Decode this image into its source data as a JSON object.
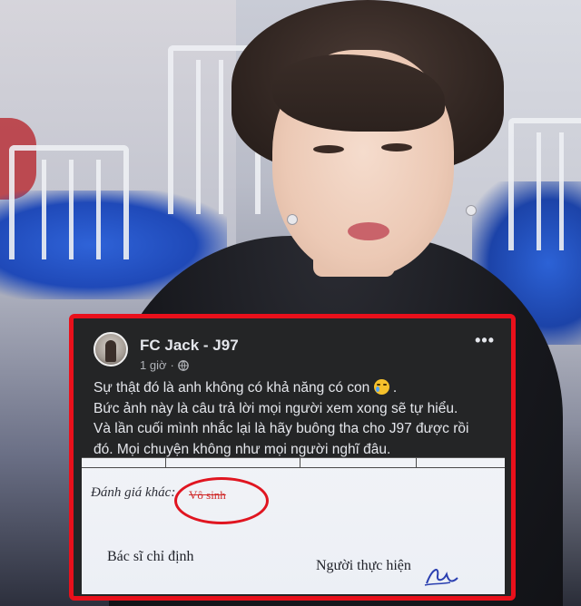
{
  "post": {
    "page_name": "FC Jack - J97",
    "time": "1 giờ",
    "separator": "·",
    "privacy_icon": "globe-icon",
    "more_icon": "more-options-icon",
    "more_label": "•••",
    "lines": [
      "Sự thật đó là anh không có khả năng có con",
      "Bức ảnh này là câu trả lời mọi người xem xong sẽ tự hiểu.",
      "Và lần cuối mình nhắc lại là hãy buông tha cho J97 được rồi",
      "đó. Mọi chuyện không như mọi người nghĩ đâu."
    ],
    "emoji": "crying-face-emoji"
  },
  "document": {
    "label_other_assessment": "Đánh giá khác:",
    "value_other_assessment": "Vô sinh",
    "label_doctor": "Bác sĩ chỉ định",
    "label_performer": "Người thực hiện"
  },
  "colors": {
    "highlight_red": "#e9101b",
    "card_bg": "#242526",
    "text_primary": "#e4e6eb",
    "text_secondary": "#b0b3b8"
  }
}
